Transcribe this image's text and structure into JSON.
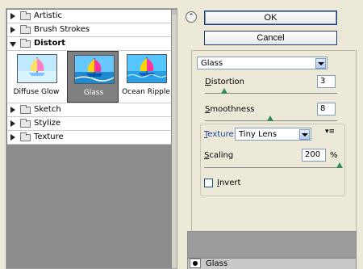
{
  "categories": [
    {
      "label": "Artistic",
      "expanded": false
    },
    {
      "label": "Brush Strokes",
      "expanded": false
    },
    {
      "label": "Distort",
      "expanded": true
    },
    {
      "label": "Sketch",
      "expanded": false
    },
    {
      "label": "Stylize",
      "expanded": false
    },
    {
      "label": "Texture",
      "expanded": false
    }
  ],
  "thumbnails": [
    {
      "label": "Diffuse Glow",
      "selected": false
    },
    {
      "label": "Glass",
      "selected": true
    },
    {
      "label": "Ocean Ripple",
      "selected": false
    }
  ],
  "buttons": {
    "ok": "OK",
    "cancel": "Cancel"
  },
  "filter_select": {
    "value": "Glass"
  },
  "distortion": {
    "label": "Distortion",
    "value": "3",
    "level": 0.15
  },
  "smoothness": {
    "label": "Smoothness",
    "value": "8",
    "level": 0.53
  },
  "texture": {
    "label": "Texture:",
    "value": "Tiny Lens"
  },
  "scaling": {
    "label": "Scaling",
    "value": "200",
    "unit": "%",
    "level": 1.0
  },
  "invert": {
    "label": "Invert",
    "checked": false
  },
  "layers": [
    {
      "name": "Glass"
    }
  ],
  "colors": {
    "panel": "#ece9d8",
    "button_border": "#1f3f7a",
    "selection": "#808080"
  }
}
